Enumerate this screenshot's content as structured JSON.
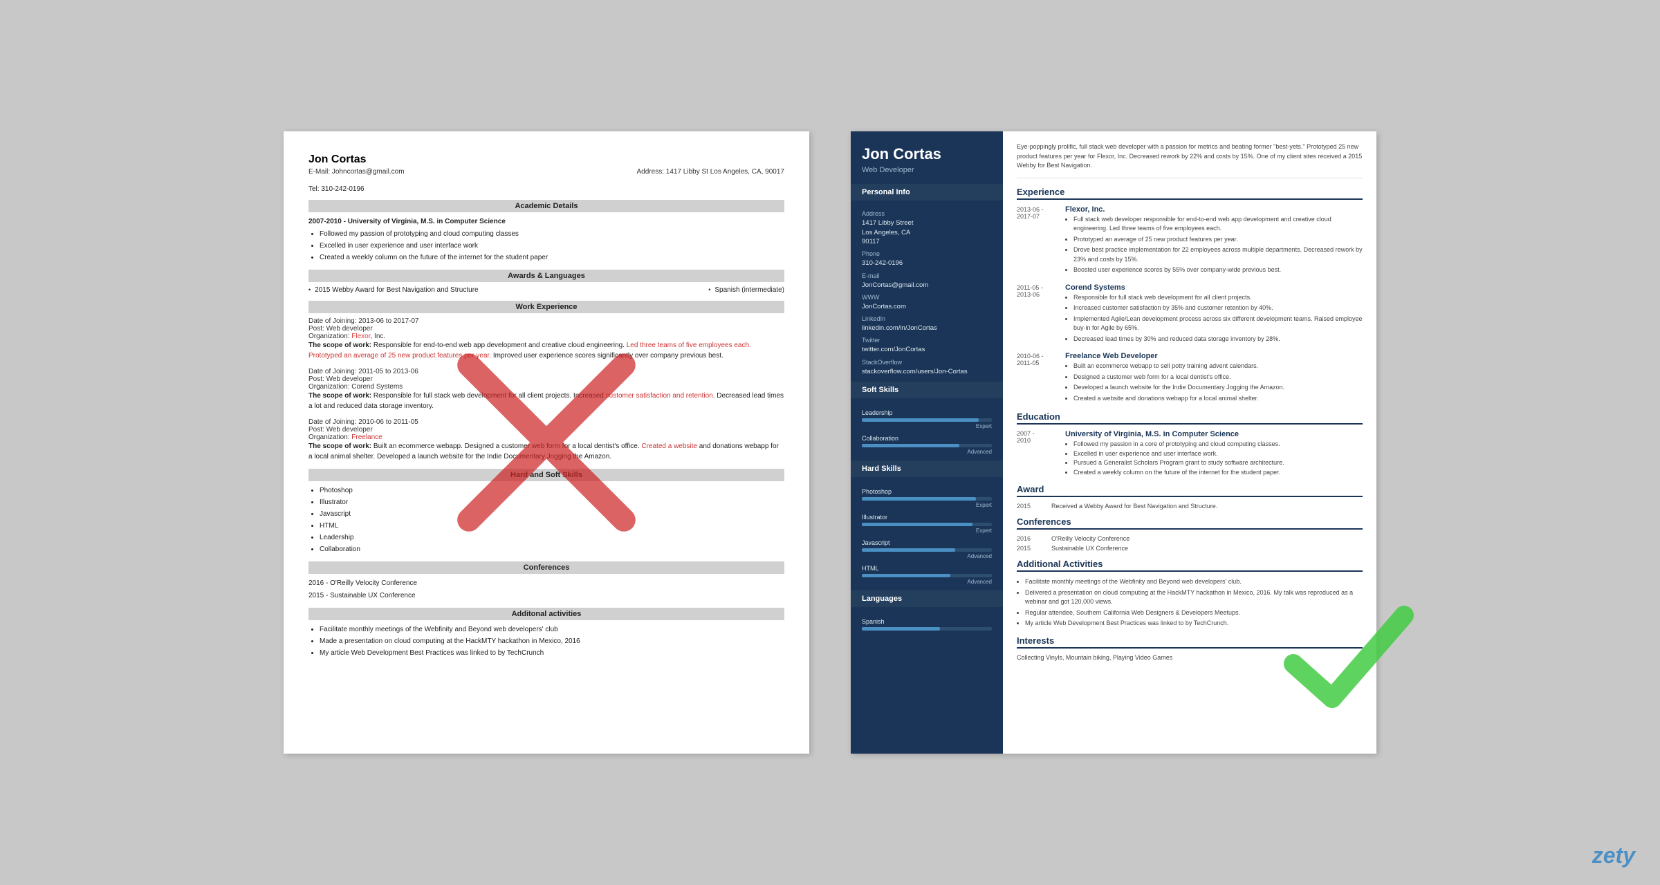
{
  "plain_resume": {
    "name": "Jon Cortas",
    "email": "E-Mail: Johncortas@gmail.com",
    "tel": "Tel: 310-242-0196",
    "address": "Address: 1417 Libby St Los Angeles, CA, 90017",
    "academic_header": "Academic Details",
    "academic_entry": "2007-2010 - University of Virginia, M.S. in Computer Science",
    "academic_bullets": [
      "Followed my passion of prototyping and cloud computing classes",
      "Excelled in user experience and user interface work",
      "Created a weekly column on the future of the internet for the student paper"
    ],
    "awards_header": "Awards & Languages",
    "award1": "2015 Webby Award for Best Navigation and Structure",
    "lang1": "Spanish (intermediate)",
    "work_header": "Work Experience",
    "work_entries": [
      {
        "date": "Date of Joining: 2013-06 to 2017-07",
        "post": "Post: Web developer",
        "org": "Organization: Flexor, Inc.",
        "scope_label": "The scope of work:",
        "scope": "Responsible for end-to-end web app development and creative cloud engineering. Led three teams of five employees each. Prototyped an average of 25 new product features per year. Improved user experience scores significantly over company previous best."
      },
      {
        "date": "Date of Joining: 2011-05 to 2013-06",
        "post": "Post: Web developer",
        "org": "Organization: Corend Systems",
        "scope_label": "The scope of work:",
        "scope": "Responsible for full stack web development for all client projects. Increased customer satisfaction and retention. Decreased lead times a lot and reduced data storage inventory."
      },
      {
        "date": "Date of Joining: 2010-06 to 2011-05",
        "post": "Post: Web developer",
        "org": "Organization: Freelance",
        "scope_label": "The scope of work:",
        "scope": "Built an ecommerce webapp. Designed a customer web form for a local dentist's office. Created a website and donations webapp for a local animal shelter. Developed a launch website for the Indie Documentary Jogging the Amazon."
      }
    ],
    "skills_header": "Hard and Soft Skills",
    "skills": [
      "Photoshop",
      "Illustrator",
      "Javascript",
      "HTML",
      "Leadership",
      "Collaboration"
    ],
    "conf_header": "Conferences",
    "conferences": [
      "2016 - O'Reilly Velocity Conference",
      "2015 - Sustainable UX Conference"
    ],
    "activities_header": "Additonal activities",
    "activities": [
      "Facilitate monthly meetings of the Webfinity and Beyond web developers' club",
      "Made a presentation on cloud computing at the HackMTY hackathon in Mexico, 2016",
      "My article Web Development Best Practices was linked to by TechCrunch"
    ]
  },
  "modern_resume": {
    "name": "Jon Cortas",
    "title": "Web Developer",
    "summary": "Eye-poppingly prolific, full stack web developer with a passion for metrics and beating former \"best-yets.\" Prototyped 25 new product features per year for Flexor, Inc. Decreased rework by 22% and costs by 15%. One of my client sites received a 2015 Webby for Best Navigation.",
    "sidebar": {
      "personal_info_title": "Personal Info",
      "address_label": "Address",
      "address_value": "1417 Libby Street\nLos Angeles, CA\n90117",
      "phone_label": "Phone",
      "phone_value": "310-242-0196",
      "email_label": "E-mail",
      "email_value": "JonCortas@gmail.com",
      "www_label": "WWW",
      "www_value": "JonCortas.com",
      "linkedin_label": "LinkedIn",
      "linkedin_value": "linkedin.com/in/JonCortas",
      "twitter_label": "Twitter",
      "twitter_value": "twitter.com/JonCortas",
      "stackoverflow_label": "StackOverflow",
      "stackoverflow_value": "stackoverflow.com/users/Jon-Cortas",
      "soft_skills_title": "Soft Skills",
      "soft_skills": [
        {
          "name": "Leadership",
          "level": "Expert",
          "pct": 90
        },
        {
          "name": "Collaboration",
          "level": "Advanced",
          "pct": 75
        }
      ],
      "hard_skills_title": "Hard Skills",
      "hard_skills": [
        {
          "name": "Photoshop",
          "level": "Expert",
          "pct": 88
        },
        {
          "name": "Illustrator",
          "level": "Expert",
          "pct": 85
        },
        {
          "name": "Javascript",
          "level": "Advanced",
          "pct": 72
        },
        {
          "name": "HTML",
          "level": "Advanced",
          "pct": 68
        }
      ],
      "languages_title": "Languages",
      "languages": [
        {
          "name": "Spanish",
          "level": "",
          "pct": 60
        }
      ]
    },
    "experience_title": "Experience",
    "experience": [
      {
        "dates": "2013-06 -\n2017-07",
        "company": "Flexor, Inc.",
        "bullets": [
          "Full stack web developer responsible for end-to-end web app development and creative cloud engineering. Led three teams of five employees each.",
          "Prototyped an average of 25 new product features per year.",
          "Drove best practice implementation for 22 employees across multiple departments. Decreased rework by 23% and costs by 15%.",
          "Boosted user experience scores by 55% over company-wide previous best."
        ]
      },
      {
        "dates": "2011-05 -\n2013-06",
        "company": "Corend Systems",
        "bullets": [
          "Responsible for full stack web development for all client projects.",
          "Increased customer satisfaction by 35% and customer retention by 40%.",
          "Implemented Agile/Lean development process across six different development teams. Raised employee buy-in for Agile by 65%.",
          "Decreased lead times by 30% and reduced data storage inventory by 28%."
        ]
      },
      {
        "dates": "2010-06 -\n2011-05",
        "company": "Freelance Web Developer",
        "bullets": [
          "Built an ecommerce webapp to sell potty training advent calendars.",
          "Designed a customer web form for a local dentist's office.",
          "Developed a launch website for the Indie Documentary Jogging the Amazon.",
          "Created a website and donations webapp for a local animal shelter."
        ]
      }
    ],
    "education_title": "Education",
    "education": [
      {
        "dates": "2007 -\n2010",
        "title": "University of Virginia, M.S. in Computer Science",
        "bullets": [
          "Followed my passion in a core of prototyping and cloud computing classes.",
          "Excelled in user experience and user interface work.",
          "Pursued a Generalist Scholars Program grant to study software architecture.",
          "Created a weekly column on the future of the internet for the student paper."
        ]
      }
    ],
    "award_title": "Award",
    "awards": [
      {
        "year": "2015",
        "text": "Received a Webby Award for Best Navigation and Structure."
      }
    ],
    "conf_title": "Conferences",
    "conferences": [
      {
        "year": "2016",
        "text": "O'Reilly Velocity Conference"
      },
      {
        "year": "2015",
        "text": "Sustainable UX Conference"
      }
    ],
    "activities_title": "Additional Activities",
    "activities": [
      "Facilitate monthly meetings of the Webfinity and Beyond web developers' club.",
      "Delivered a presentation on cloud computing at the HackMTY hackathon in Mexico, 2016. My talk was reproduced as a webinar and got 120,000 views.",
      "Regular attendee, Southern California Web Designers & Developers Meetups.",
      "My article Web Development Best Practices was linked to by TechCrunch."
    ],
    "interests_title": "Interests",
    "interests": "Collecting Vinyls, Mountain biking, Playing Video Games"
  },
  "zety_label": "zety"
}
